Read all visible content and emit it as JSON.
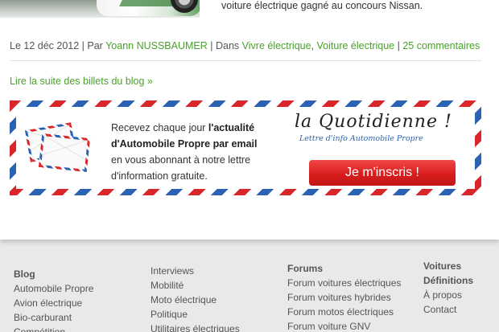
{
  "post": {
    "excerpt": "voiture électrique gagné au concours Nissan.",
    "date_prefix": "Le 12 déc 2012 | Par ",
    "author": "Yoann NUSSBAUMER",
    "in_label": " | Dans ",
    "cat1": "Vivre électrique",
    "comma": ", ",
    "cat2": "Voiture électrique",
    "pipe": " | ",
    "comments": "25 commentaires"
  },
  "read_more": "Lire la suite des billets du blog »",
  "newsletter": {
    "line1_pre": "Recevez chaque jour ",
    "line1_bold": "l'actualité",
    "line2_bold": "d'Automobile Propre par email",
    "line3": "en vous abonnant à notre lettre",
    "line4": "d'information gratuite.",
    "brand_title": "la Quotidienne !",
    "brand_subtitle": "Lettre d'info Automobile Propre",
    "cta": "Je m'inscris !"
  },
  "footer": {
    "col1": {
      "head": "Blog",
      "items": [
        "Automobile Propre",
        "Avion électrique",
        "Bio-carburant",
        "Compétition"
      ]
    },
    "col2": {
      "items": [
        "Interviews",
        "Mobilité",
        "Moto électrique",
        "Politique",
        "Utilitaires électriques"
      ]
    },
    "col3": {
      "head": "Forums",
      "items": [
        "Forum voitures électriques",
        "Forum voitures hybrides",
        "Forum motos électriques",
        "Forum voiture GNV"
      ]
    },
    "col4": {
      "head1": "Voitures",
      "head2": "Définitions",
      "items": [
        "À propos",
        "Contact"
      ]
    }
  },
  "colors": {
    "link_green": "#4aa02c",
    "cta_red": "#d91e1e",
    "airmail_blue": "#2b62b3"
  }
}
